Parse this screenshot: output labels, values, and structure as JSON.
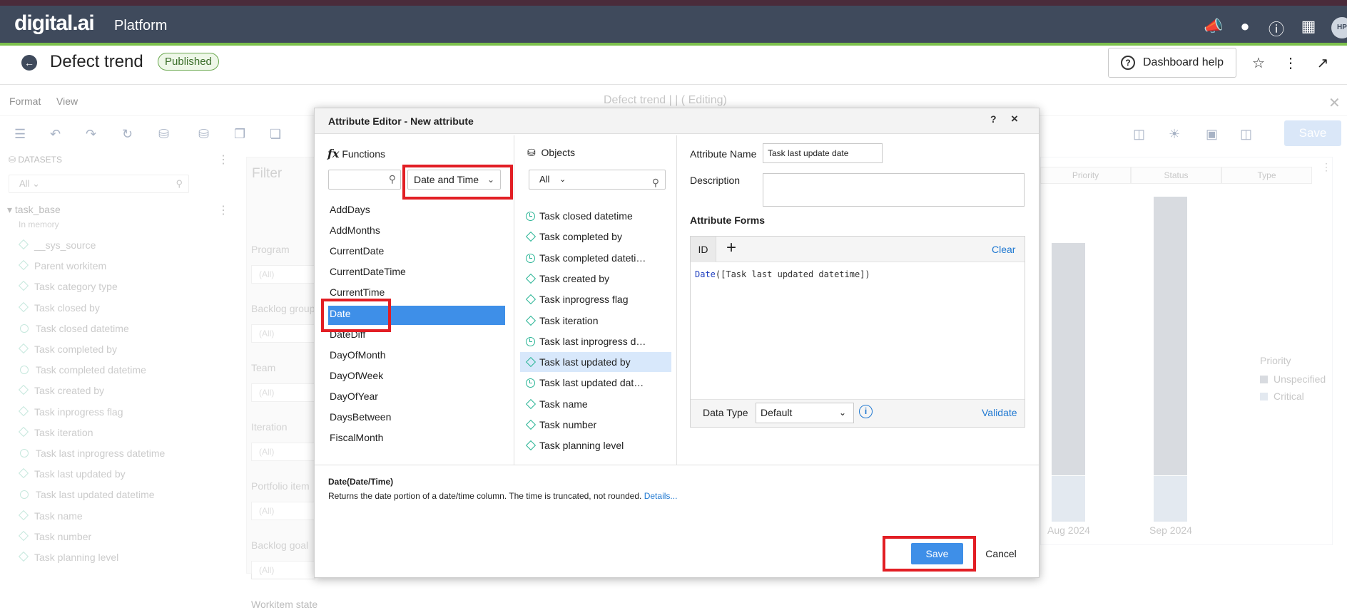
{
  "app": {
    "logo": "digital.ai",
    "product": "Platform",
    "avatar_initials": "HP"
  },
  "header": {
    "title": "Defect trend",
    "status_badge": "Published",
    "dashboard_help": "Dashboard help"
  },
  "menubar": {
    "items": [
      "Format",
      "View"
    ],
    "center_title": "Defect trend |   |  ( Editing)",
    "save_label": "Save"
  },
  "datasets": {
    "heading": "DATASETS",
    "filter_value": "All",
    "dataset_name": "task_base",
    "dataset_sub": "In memory",
    "items": [
      {
        "label": "__sys_source",
        "icon": "diamond"
      },
      {
        "label": "Parent workitem",
        "icon": "diamond"
      },
      {
        "label": "Task category type",
        "icon": "diamond"
      },
      {
        "label": "Task closed by",
        "icon": "diamond"
      },
      {
        "label": "Task closed datetime",
        "icon": "clock"
      },
      {
        "label": "Task completed by",
        "icon": "diamond"
      },
      {
        "label": "Task completed datetime",
        "icon": "clock"
      },
      {
        "label": "Task created by",
        "icon": "diamond"
      },
      {
        "label": "Task inprogress flag",
        "icon": "diamond"
      },
      {
        "label": "Task iteration",
        "icon": "diamond"
      },
      {
        "label": "Task last inprogress datetime",
        "icon": "clock"
      },
      {
        "label": "Task last updated by",
        "icon": "diamond"
      },
      {
        "label": "Task last updated datetime",
        "icon": "clock"
      },
      {
        "label": "Task name",
        "icon": "diamond"
      },
      {
        "label": "Task number",
        "icon": "diamond"
      },
      {
        "label": "Task planning level",
        "icon": "diamond"
      }
    ]
  },
  "filter_panel": {
    "title": "Filter",
    "filters": [
      {
        "label": "Program",
        "value": "(All)"
      },
      {
        "label": "Backlog group",
        "value": "(All)"
      },
      {
        "label": "Team",
        "value": "(All)"
      },
      {
        "label": "Iteration",
        "value": "(All)"
      },
      {
        "label": "Portfolio item",
        "value": "(All)"
      },
      {
        "label": "Backlog goal",
        "value": "(All)"
      },
      {
        "label": "Workitem state",
        "value": ""
      }
    ]
  },
  "chart_bg": {
    "columns": [
      "Priority",
      "Status",
      "Type"
    ],
    "x_labels": [
      "Aug 2024",
      "Sep 2024"
    ],
    "legend_title": "Priority",
    "legend": [
      {
        "label": "Unspecified",
        "color": "#c4c8cf"
      },
      {
        "label": "Critical",
        "color": "#d5dde8"
      }
    ]
  },
  "dialog": {
    "title": "Attribute Editor - New attribute",
    "help": "?",
    "close": "×",
    "functions": {
      "label": "Functions",
      "search_value": "",
      "category": "Date and Time",
      "items": [
        "AddDays",
        "AddMonths",
        "CurrentDate",
        "CurrentDateTime",
        "CurrentTime",
        "Date",
        "DateDiff",
        "DayOfMonth",
        "DayOfWeek",
        "DayOfYear",
        "DaysBetween",
        "FiscalMonth"
      ],
      "selected": "Date"
    },
    "objects": {
      "label": "Objects",
      "filter": "All",
      "items": [
        {
          "label": "Task closed datetime",
          "icon": "clock"
        },
        {
          "label": "Task completed by",
          "icon": "diamond"
        },
        {
          "label": "Task completed dateti…",
          "icon": "clock"
        },
        {
          "label": "Task created by",
          "icon": "diamond"
        },
        {
          "label": "Task inprogress flag",
          "icon": "diamond"
        },
        {
          "label": "Task iteration",
          "icon": "diamond"
        },
        {
          "label": "Task last inprogress d…",
          "icon": "clock"
        },
        {
          "label": "Task last updated by",
          "icon": "diamond"
        },
        {
          "label": "Task last updated dat…",
          "icon": "clock"
        },
        {
          "label": "Task name",
          "icon": "diamond"
        },
        {
          "label": "Task number",
          "icon": "diamond"
        },
        {
          "label": "Task planning level",
          "icon": "diamond"
        }
      ],
      "selected": "Task last updated by"
    },
    "attribute": {
      "name_label": "Attribute Name",
      "name_value": "Task last update date",
      "description_label": "Description",
      "description_value": "",
      "forms_label": "Attribute Forms",
      "id_tab": "ID",
      "add": "+",
      "clear": "Clear",
      "formula_fn": "Date",
      "formula_args": "([Task last updated datetime])",
      "data_type_label": "Data Type",
      "data_type_value": "Default",
      "validate": "Validate"
    },
    "signature": "Date(Date/Time)",
    "description": "Returns the date portion of a date/time column. The time is truncated, not rounded.",
    "details_link": "Details...",
    "save": "Save",
    "cancel": "Cancel"
  },
  "colors": {
    "accent": "#3e8fe8",
    "highlight": "#e21e24",
    "topbar": "#3f4a5c",
    "object_icon": "#2bb596"
  }
}
